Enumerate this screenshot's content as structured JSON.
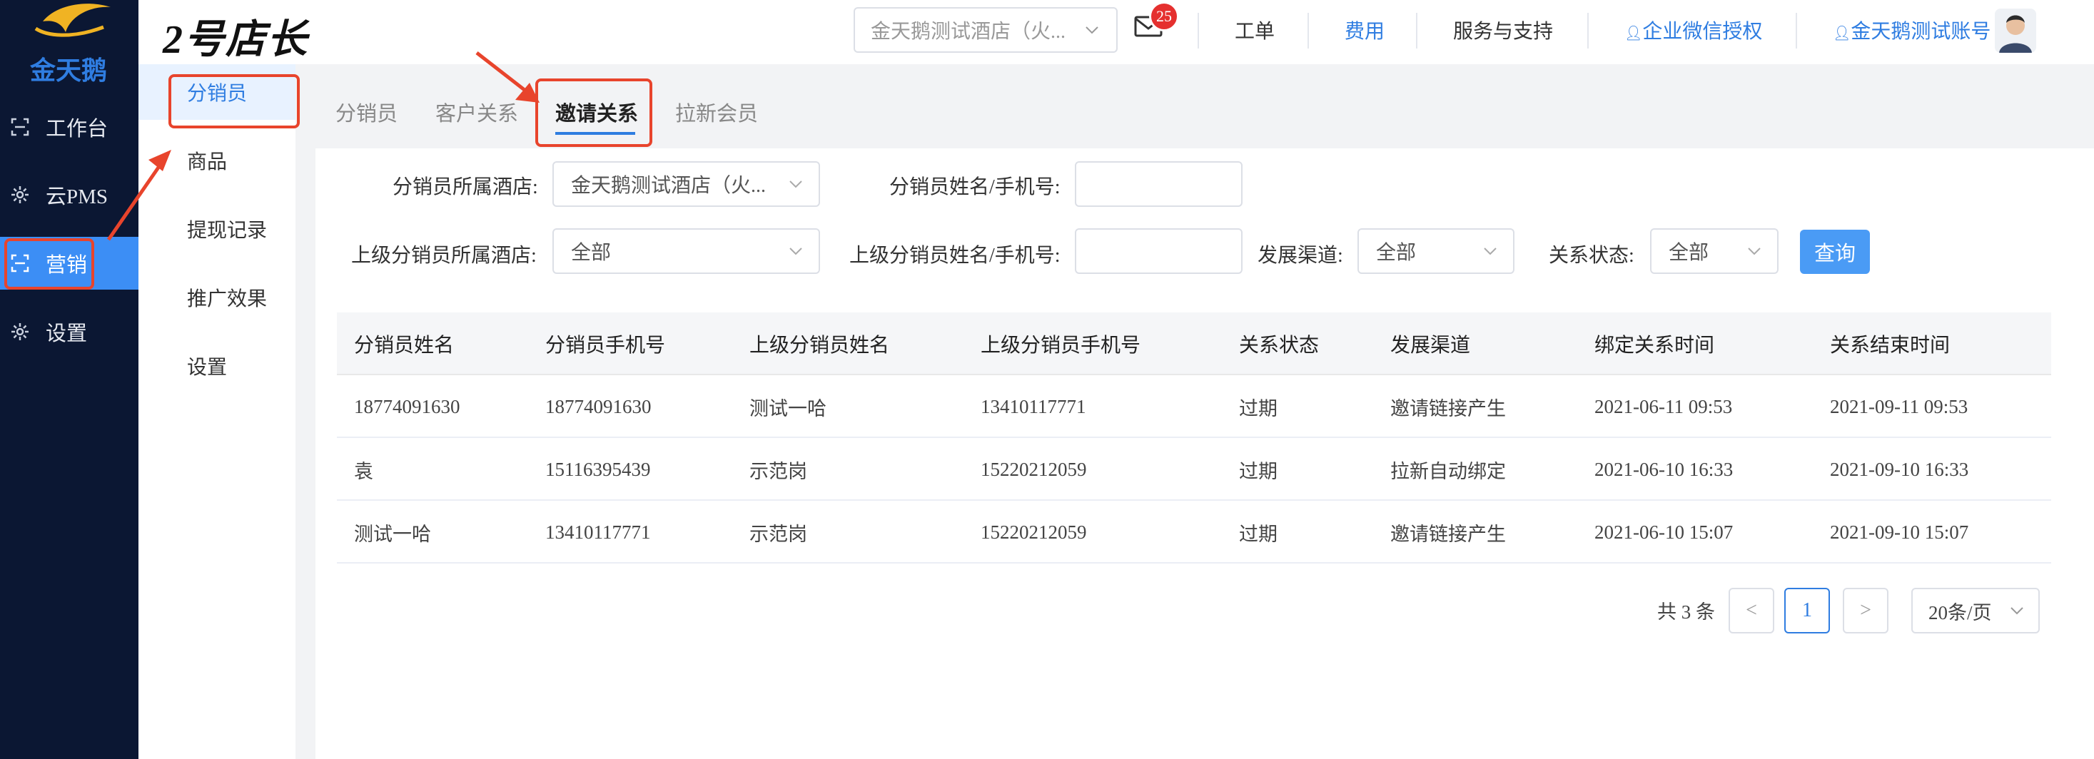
{
  "sidebar": {
    "logo_text": "金天鹅",
    "items": [
      {
        "label": "工作台",
        "icon": "scan-icon"
      },
      {
        "label": "云PMS",
        "icon": "gear-icon"
      },
      {
        "label": "营销",
        "icon": "scan-icon"
      },
      {
        "label": "设置",
        "icon": "gear-icon"
      }
    ]
  },
  "submenu": {
    "items": [
      {
        "label": "分销员"
      },
      {
        "label": "商品"
      },
      {
        "label": "提现记录"
      },
      {
        "label": "推广效果"
      },
      {
        "label": "设置"
      }
    ]
  },
  "header": {
    "brand": "2号店长",
    "hotel_select": "金天鹅测试酒店（火...",
    "mail_badge": "25",
    "links": {
      "work_order": "工单",
      "fees": "费用",
      "service": "服务与支持",
      "wecom_auth": "企业微信授权",
      "account": "金天鹅测试账号"
    }
  },
  "tabs": [
    {
      "label": "分销员"
    },
    {
      "label": "客户关系"
    },
    {
      "label": "邀请关系"
    },
    {
      "label": "拉新会员"
    }
  ],
  "filters": {
    "hotel_label": "分销员所属酒店:",
    "hotel_value": "金天鹅测试酒店（火...",
    "name_label": "分销员姓名/手机号:",
    "name_value": "",
    "parent_hotel_label": "上级分销员所属酒店:",
    "parent_hotel_value": "全部",
    "parent_name_label": "上级分销员姓名/手机号:",
    "parent_name_value": "",
    "channel_label": "发展渠道:",
    "channel_value": "全部",
    "status_label": "关系状态:",
    "status_value": "全部",
    "query_button": "查询"
  },
  "table": {
    "headers": [
      "分销员姓名",
      "分销员手机号",
      "上级分销员姓名",
      "上级分销员手机号",
      "关系状态",
      "发展渠道",
      "绑定关系时间",
      "关系结束时间"
    ],
    "rows": [
      [
        "18774091630",
        "18774091630",
        "测试一哈",
        "13410117771",
        "过期",
        "邀请链接产生",
        "2021-06-11 09:53",
        "2021-09-11 09:53"
      ],
      [
        "袁",
        "15116395439",
        "示范岗",
        "15220212059",
        "过期",
        "拉新自动绑定",
        "2021-06-10 16:33",
        "2021-09-10 16:33"
      ],
      [
        "测试一哈",
        "13410117771",
        "示范岗",
        "15220212059",
        "过期",
        "邀请链接产生",
        "2021-06-10 15:07",
        "2021-09-10 15:07"
      ]
    ]
  },
  "pagination": {
    "total": "共 3 条",
    "prev": "<",
    "current": "1",
    "next": ">",
    "page_size": "20条/页"
  },
  "colors": {
    "accent": "#2f7de1",
    "sidebar_bg": "#0b1733",
    "active_nav": "#3c8ef5",
    "badge": "#e5302f",
    "annotation": "#e8442c"
  }
}
